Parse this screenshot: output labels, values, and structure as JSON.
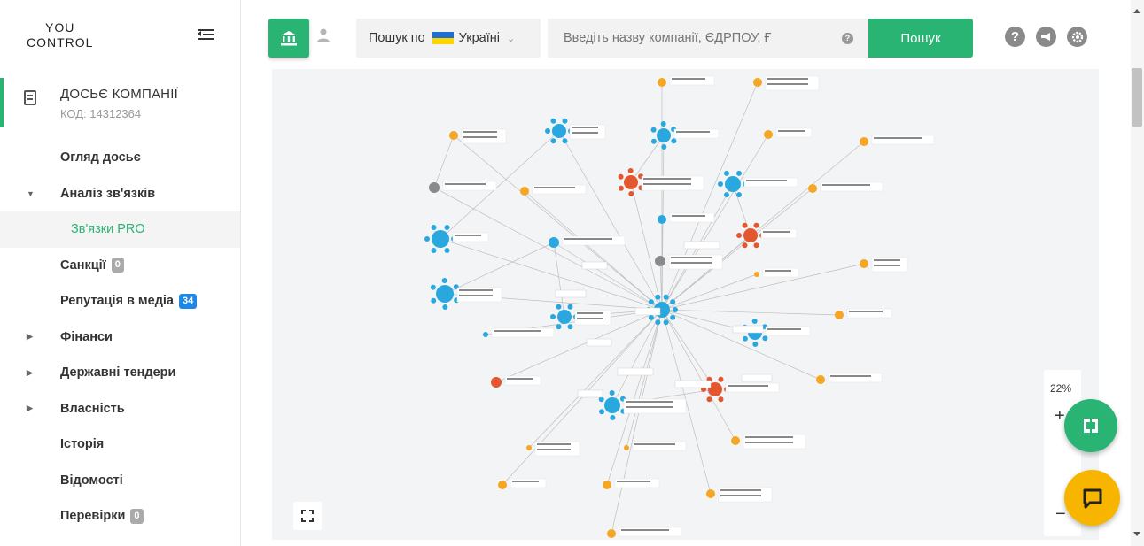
{
  "logo": {
    "line1": "YOU",
    "line2": "CONTROL"
  },
  "dossier": {
    "title": "ДОСЬЄ КОМПАНІЇ",
    "code": "КОД: 14312364"
  },
  "nav": [
    {
      "label": "Огляд досьє",
      "arrow": ""
    },
    {
      "label": "Аналіз зв'язків",
      "arrow": "▼"
    },
    {
      "label": "Зв'язки PRO",
      "arrow": "",
      "active": true
    },
    {
      "label": "Санкції",
      "arrow": "",
      "badge": "0"
    },
    {
      "label": "Репутація в медіа",
      "arrow": "",
      "badge": "34"
    },
    {
      "label": "Фінанси",
      "arrow": "▶"
    },
    {
      "label": "Державні тендери",
      "arrow": "▶"
    },
    {
      "label": "Власність",
      "arrow": "▶"
    },
    {
      "label": "Історія",
      "arrow": ""
    },
    {
      "label": "Відомості",
      "arrow": ""
    },
    {
      "label": "Перевірки",
      "arrow": "",
      "badge": "0"
    }
  ],
  "search": {
    "by_prefix": "Пошук по",
    "country": "Україні",
    "placeholder": "Введіть назву компанії, ЄДРПОУ, Ғ",
    "button": "Пошук",
    "help": "?"
  },
  "top_icons": [
    "question-icon",
    "megaphone-icon",
    "settings-icon"
  ],
  "zoom": {
    "level": "22%",
    "plus": "+",
    "minus": "−"
  },
  "colors": {
    "accent": "#29b473",
    "company": "#29a8e0",
    "person": "#f5a623",
    "bank": "#e4572e",
    "sanction": "#1e88e5",
    "fab_yellow": "#f7b500"
  }
}
